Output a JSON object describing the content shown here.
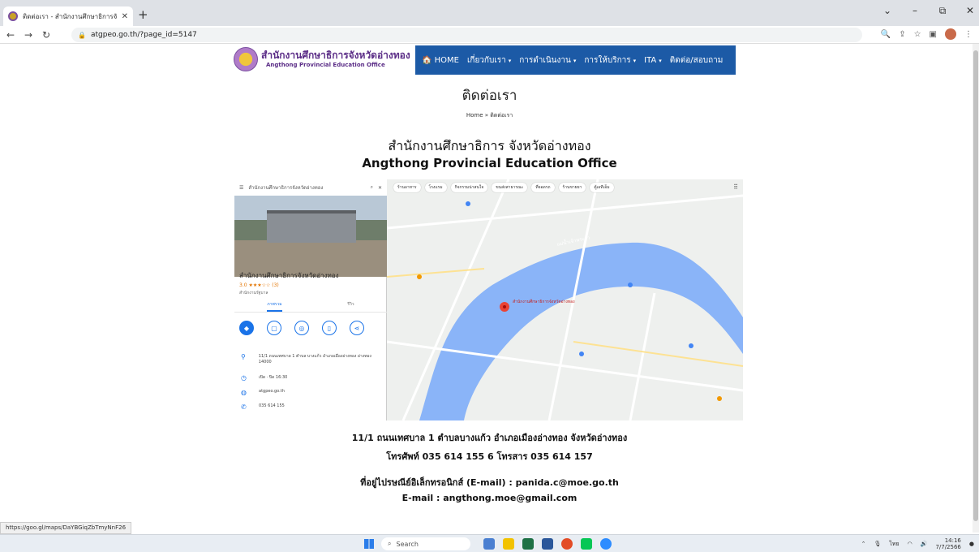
{
  "browser": {
    "tab_title": "ติดต่อเรา - สำนักงานศึกษาธิการจังหวัดอ่างทอง",
    "new_tab": "+",
    "url": "atgpeo.go.th/?page_id=5147",
    "win_controls": [
      "⌄",
      "–",
      "⧉",
      "✕"
    ],
    "status_url": "https://goo.gl/maps/DaYBGiqZbTmyNnF26"
  },
  "header": {
    "logo_th": "สำนักงานศึกษาธิการจังหวัดอ่างทอง",
    "logo_en": "Angthong Provincial Education Office",
    "menu": [
      {
        "label": "🏠 HOME",
        "caret": false
      },
      {
        "label": "เกี่ยวกับเรา",
        "caret": true
      },
      {
        "label": "การดำเนินงาน",
        "caret": true
      },
      {
        "label": "การให้บริการ",
        "caret": true
      },
      {
        "label": "ITA",
        "caret": true
      },
      {
        "label": "ติดต่อ/สอบถาม",
        "caret": false
      }
    ]
  },
  "page": {
    "title": "ติดต่อเรา",
    "breadcrumb": "Home » ติดต่อเรา",
    "org_th": "สำนักงานศึกษาธิการ จังหวัดอ่างทอง",
    "org_en": "Angthong Provincial Education Office"
  },
  "map": {
    "search_text": "สำนักงานศึกษาธิการจังหวัดอ่างทอง",
    "place_name": "สำนักงานศึกษาธิการจังหวัดอ่างทอง",
    "rating": "3.0 ★★★☆☆ (3)",
    "category": "สำนักงานรัฐบาล",
    "tabs": [
      "ภาพรวม",
      "รีวิว"
    ],
    "address": "11/1 ถนนเทศบาล 1 ตำบล บางแก้ว อำเภอเมืองอ่างทอง อ่างทอง 14000",
    "hours": "เปิด · ปิด 16:30",
    "website": "atgpeo.go.th",
    "phone": "035 614 155",
    "chips": [
      "ร้านอาหาร",
      "โรงแรม",
      "กิจกรรมน่าสนใจ",
      "ขนส่งสาธารณะ",
      "ที่จอดรถ",
      "ร้านขายยา",
      "ตู้เอทีเอ็ม"
    ],
    "pin_label": "สำนักงานศึกษาธิการจังหวัดอ่างทอง",
    "river_label": "แม่น้ำเจ้าพระยา"
  },
  "contact": {
    "address": "11/1 ถนนเทศบาล 1 ตำบลบางแก้ว อำเภอเมืองอ่างทอง จังหวัดอ่างทอง",
    "phone": "โทรศัพท์ 035 614 155 6 โทรสาร 035 614 157",
    "email_line": "ที่อยู่ไปรษณีย์อิเล็กทรอนิกส์ (E-mail) : panida.c@moe.go.th",
    "email2": "E-mail : angthong.moe@gmail.com"
  },
  "taskbar": {
    "search": "Search",
    "lang": "ไทย",
    "time": "14:16",
    "date": "7/7/2566"
  }
}
